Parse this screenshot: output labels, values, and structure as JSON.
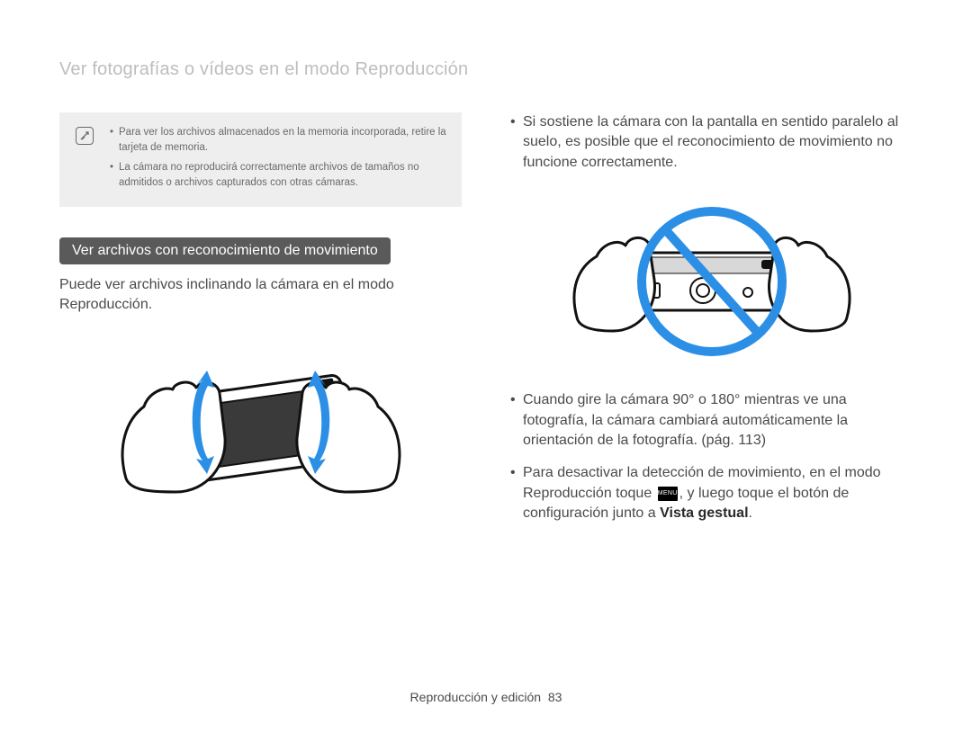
{
  "page_title": "Ver fotografías o vídeos en el modo Reproducción",
  "note": {
    "items": [
      "Para ver los archivos almacenados en la memoria incorporada, retire la tarjeta de memoria.",
      "La cámara no reproducirá correctamente archivos de tamaños no admitidos o archivos capturados con otras cámaras."
    ]
  },
  "section_heading": "Ver archivos con reconocimiento de movimiento",
  "section_body": "Puede ver archivos inclinando la cámara en el modo Reproducción.",
  "right": {
    "bullet1": "Si sostiene la cámara con la pantalla en sentido paralelo al suelo, es posible que el reconocimiento de movimiento no funcione correctamente.",
    "bullet2": "Cuando gire la cámara 90° o 180° mientras ve una fotografía, la cámara cambiará automáticamente la orientación de la fotografía. (pág. 113)",
    "bullet3_pre": "Para desactivar la detección de movimiento, en el modo Reproducción toque ",
    "menu_label": "MENU",
    "bullet3_mid": ", y luego toque el botón de configuración junto a ",
    "bullet3_bold": "Vista gestual",
    "bullet3_post": "."
  },
  "footer": {
    "section": "Reproducción y edición",
    "page": "83"
  }
}
